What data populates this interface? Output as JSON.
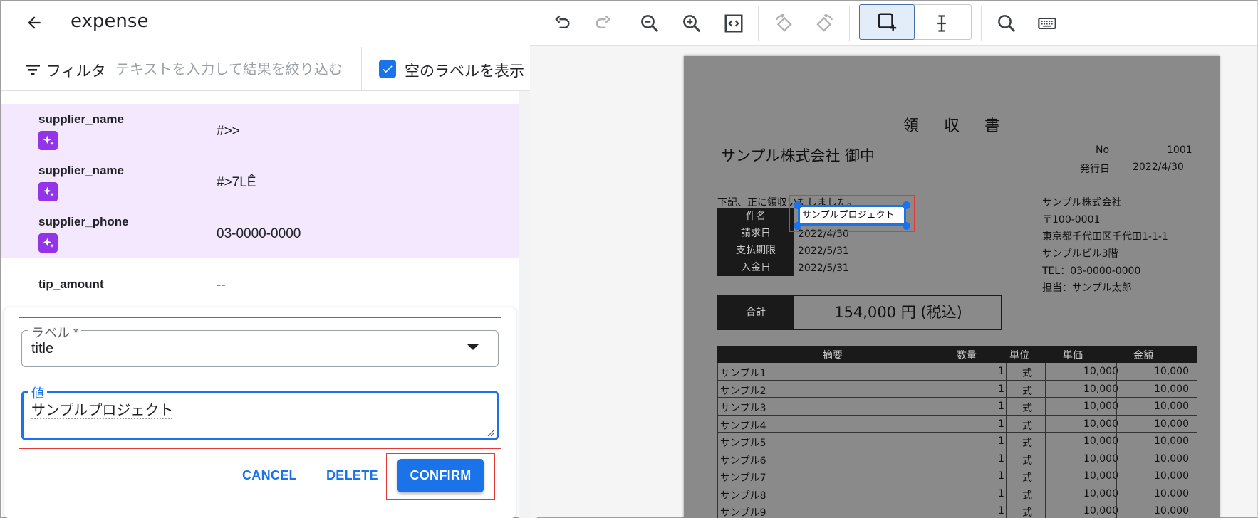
{
  "header": {
    "title": "expense"
  },
  "filter": {
    "label": "フィルタ",
    "placeholder": "テキストを入力して結果を絞り込む",
    "show_empty_label": "空のラベルを表示",
    "show_empty_checked": true
  },
  "fields": [
    {
      "key": "supplier_name",
      "value": "#>>",
      "ai": true
    },
    {
      "key": "supplier_name",
      "value": "#>7LÊ",
      "ai": true
    },
    {
      "key": "supplier_phone",
      "value": "03-0000-0000",
      "ai": true
    },
    {
      "key": "tip_amount",
      "value": "--",
      "ai": false
    }
  ],
  "editor": {
    "label_field_label": "ラベル *",
    "label_value": "title",
    "value_field_label": "値",
    "value_text": "サンプルプロジェクト",
    "cancel": "CANCEL",
    "delete": "DELETE",
    "confirm": "CONFIRM"
  },
  "toolbar": {
    "tools": [
      "undo-icon",
      "redo-icon",
      "zoom-out-icon",
      "zoom-in-icon",
      "fit-code-icon",
      "rotate-left-icon",
      "rotate-right-icon",
      "draw-box-icon",
      "text-cursor-icon",
      "search-icon",
      "keyboard-icon"
    ],
    "active_tool": "draw-box-icon"
  },
  "document": {
    "title": "領 収 書",
    "addressee": "サンプル株式会社 御中",
    "no_label": "No",
    "no_value": "1001",
    "issue_label": "発行日",
    "issue_value": "2022/4/30",
    "intro": "下記、正に領収いたしました。",
    "info": [
      {
        "label": "件名",
        "value": "サンプルプロジェクト"
      },
      {
        "label": "請求日",
        "value": "2022/4/30"
      },
      {
        "label": "支払期限",
        "value": "2022/5/31"
      },
      {
        "label": "入金日",
        "value": "2022/5/31"
      }
    ],
    "issuer": [
      "サンプル株式会社",
      "〒100-0001",
      "東京都千代田区千代田1-1-1",
      "サンプルビル3階",
      "TEL：03-0000-0000",
      "担当：サンプル太郎"
    ],
    "total_label": "合計",
    "total_value": "154,000 円 (税込)",
    "table_headers": [
      "摘要",
      "数量",
      "単位",
      "単価",
      "金額"
    ],
    "items": [
      {
        "name": "サンプル1",
        "qty": "1",
        "unit": "式",
        "price": "10,000",
        "amount": "10,000"
      },
      {
        "name": "サンプル2",
        "qty": "1",
        "unit": "式",
        "price": "10,000",
        "amount": "10,000"
      },
      {
        "name": "サンプル3",
        "qty": "1",
        "unit": "式",
        "price": "10,000",
        "amount": "10,000"
      },
      {
        "name": "サンプル4",
        "qty": "1",
        "unit": "式",
        "price": "10,000",
        "amount": "10,000"
      },
      {
        "name": "サンプル5",
        "qty": "1",
        "unit": "式",
        "price": "10,000",
        "amount": "10,000"
      },
      {
        "name": "サンプル6",
        "qty": "1",
        "unit": "式",
        "price": "10,000",
        "amount": "10,000"
      },
      {
        "name": "サンプル7",
        "qty": "1",
        "unit": "式",
        "price": "10,000",
        "amount": "10,000"
      },
      {
        "name": "サンプル8",
        "qty": "1",
        "unit": "式",
        "price": "10,000",
        "amount": "10,000"
      },
      {
        "name": "サンプル9",
        "qty": "1",
        "unit": "式",
        "price": "10,000",
        "amount": "10,000"
      }
    ]
  },
  "colors": {
    "accent": "#1a73e8",
    "ai_badge": "#9334e6",
    "highlight_row": "#f3e8fd",
    "annotation_red": "#e53935"
  }
}
